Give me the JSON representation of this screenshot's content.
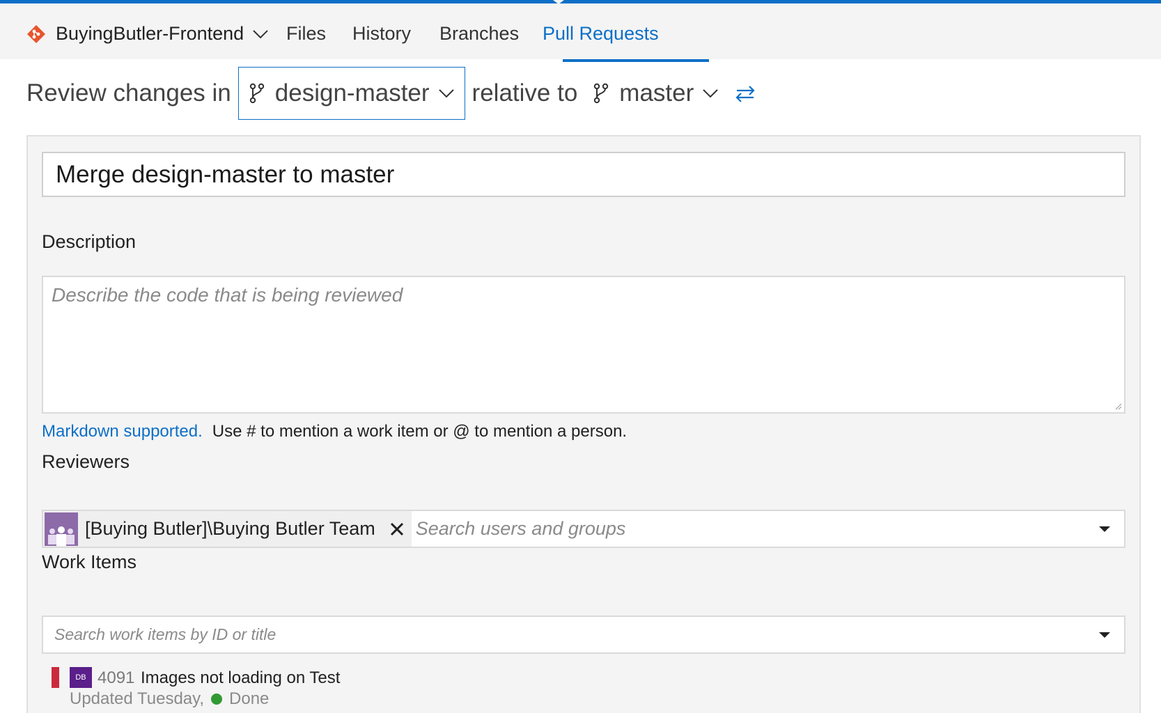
{
  "header": {
    "repo_name": "BuyingButler-Frontend",
    "tabs": [
      {
        "label": "Files"
      },
      {
        "label": "History"
      },
      {
        "label": "Branches"
      },
      {
        "label": "Pull Requests"
      }
    ],
    "active_tab": "Pull Requests"
  },
  "review": {
    "prefix": "Review changes in",
    "source_branch": "design-master",
    "relative_label": "relative to",
    "target_branch": "master"
  },
  "form": {
    "title_value": "Merge design-master to master",
    "description_label": "Description",
    "description_placeholder": "Describe the code that is being reviewed",
    "markdown_link": "Markdown supported.",
    "markdown_hint": "Use # to mention a work item or @ to mention a person.",
    "reviewers_label": "Reviewers",
    "reviewer_chip": "[Buying Butler]\\Buying Butler Team",
    "reviewers_placeholder": "Search users and groups",
    "work_items_label": "Work Items",
    "work_items_placeholder": "Search work items by ID or title"
  },
  "work_item": {
    "avatar_initials": "DB",
    "id": "4091",
    "title": "Images not loading on Test",
    "updated": "Updated Tuesday,",
    "state": "Done"
  },
  "colors": {
    "accent": "#0c6fc7",
    "work_item_type": "#cc293d",
    "state_done": "#339933",
    "team_avatar": "#8c6ba8"
  },
  "icons": {
    "repo": "git-repo-icon",
    "branch": "branch-icon",
    "swap": "swap-arrows-icon",
    "remove": "close-icon"
  }
}
